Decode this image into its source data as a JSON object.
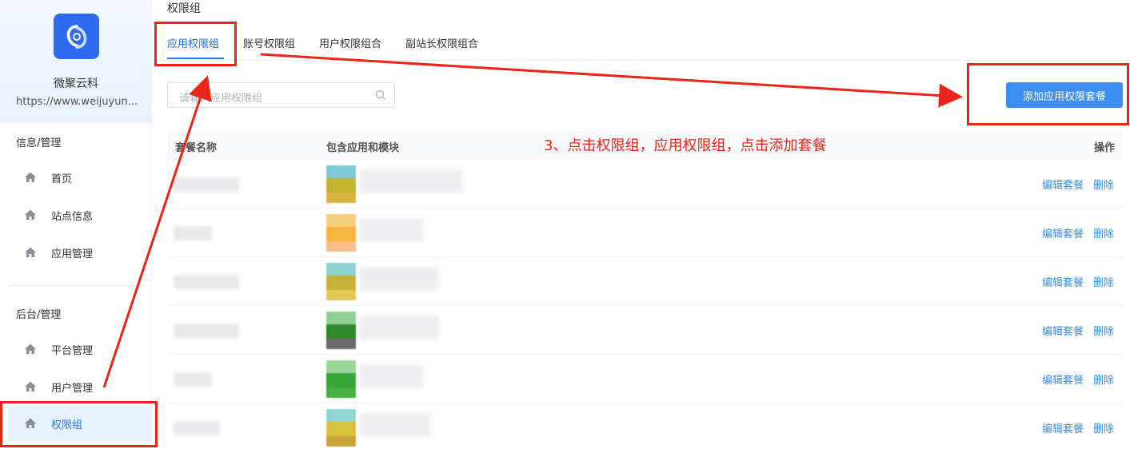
{
  "brand": {
    "name": "微聚云科",
    "url": "https://www.weijuyun..."
  },
  "sidebar": {
    "group1": "信息/管理",
    "group2": "后台/管理",
    "items": [
      {
        "label": "首页",
        "icon": "home-icon"
      },
      {
        "label": "站点信息",
        "icon": "home-icon"
      },
      {
        "label": "应用管理",
        "icon": "home-icon"
      },
      {
        "label": "平台管理",
        "icon": "home-icon"
      },
      {
        "label": "用户管理",
        "icon": "home-icon"
      },
      {
        "label": "权限组",
        "icon": "home-icon",
        "active": true
      }
    ]
  },
  "page": {
    "title": "权限组"
  },
  "tabs": [
    {
      "label": "应用权限组",
      "active": true
    },
    {
      "label": "账号权限组"
    },
    {
      "label": "用户权限组合"
    },
    {
      "label": "副站长权限组合"
    }
  ],
  "search": {
    "placeholder": "请输入应用权限组"
  },
  "add_button": "添加应用权限套餐",
  "table": {
    "headers": [
      "套餐名称",
      "包含应用和模块",
      "操作"
    ],
    "rows": [
      {
        "edit": "编辑套餐",
        "delete": "删除"
      },
      {
        "edit": "编辑套餐",
        "delete": "删除"
      },
      {
        "edit": "编辑套餐",
        "delete": "删除"
      },
      {
        "edit": "编辑套餐",
        "delete": "删除"
      },
      {
        "edit": "编辑套餐",
        "delete": "删除"
      },
      {
        "edit": "编辑套餐",
        "delete": "删除"
      }
    ]
  },
  "annotation": "3、点击权限组，应用权限组，点击添加套餐",
  "colors": {
    "accent": "#2f78e8",
    "button": "#3c8ef1",
    "annotation": "#e8261a"
  }
}
